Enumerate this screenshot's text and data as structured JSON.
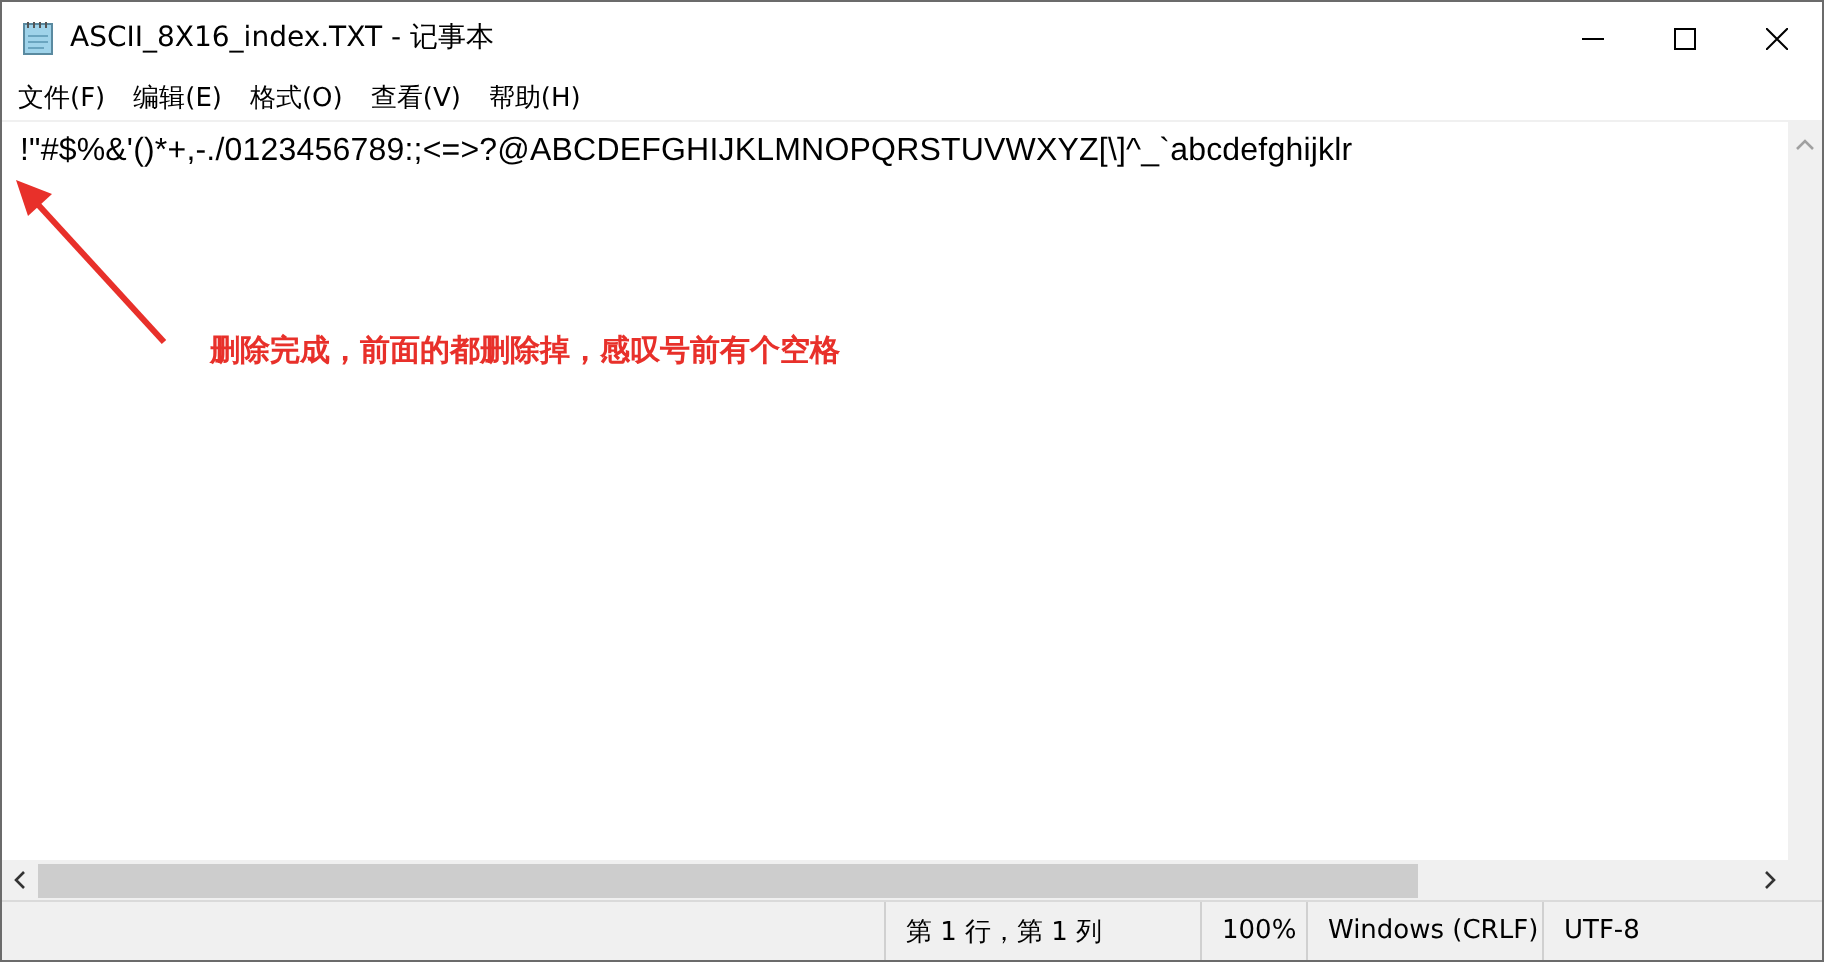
{
  "window": {
    "title": "ASCII_8X16_index.TXT - 记事本"
  },
  "menu": [
    {
      "label": "文件(F)"
    },
    {
      "label": "编辑(E)"
    },
    {
      "label": "格式(O)"
    },
    {
      "label": "查看(V)"
    },
    {
      "label": "帮助(H)"
    }
  ],
  "document": {
    "text": "!\"#$%&'()*+,-./0123456789:;<=>?@ABCDEFGHIJKLMNOPQRSTUVWXYZ[\\]^_`abcdefghijklr"
  },
  "annotation": {
    "text": "删除完成，前面的都删除掉，感叹号前有个空格"
  },
  "status_bar": [
    {
      "text": "第 1 行，第 1 列"
    },
    {
      "text": "100%"
    },
    {
      "text": "Windows (CRLF)"
    },
    {
      "text": "UTF-8"
    }
  ]
}
